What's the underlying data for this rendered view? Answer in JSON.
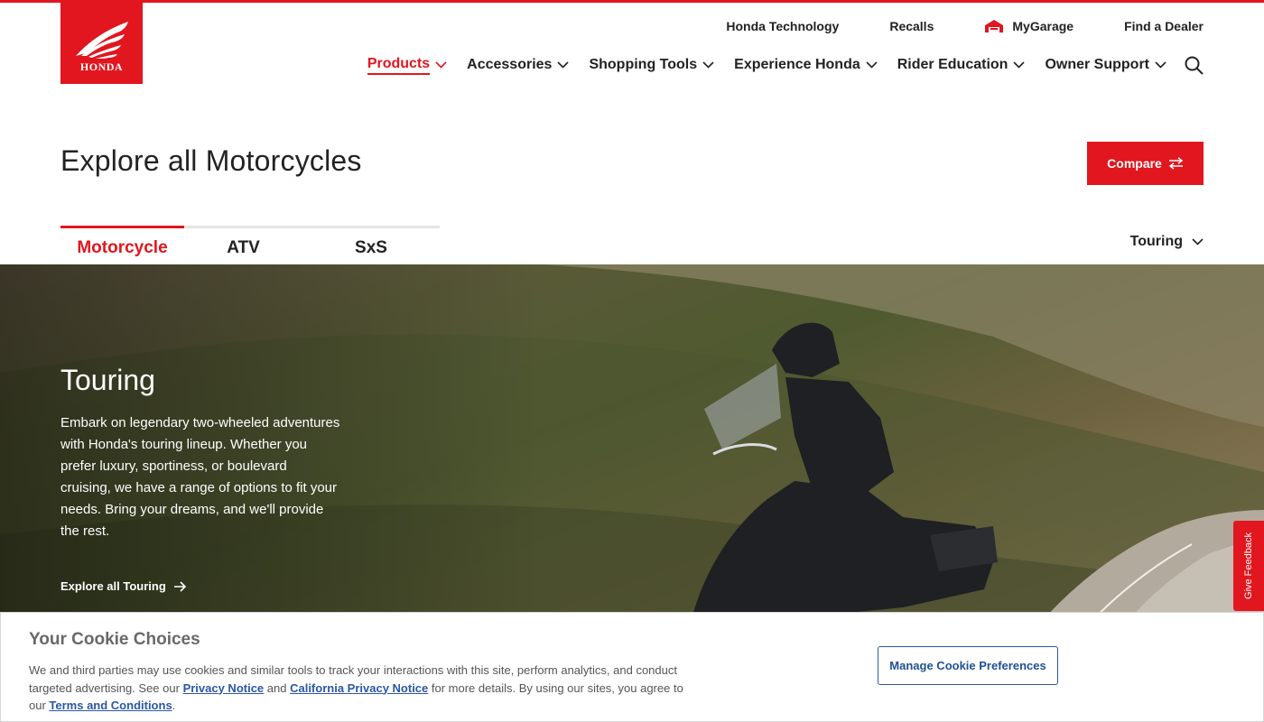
{
  "brand": {
    "logo_text": "HONDA",
    "accent_color": "#e1161e"
  },
  "utility_nav": {
    "technology": "Honda Technology",
    "recalls": "Recalls",
    "garage": "MyGarage",
    "dealer": "Find a Dealer"
  },
  "main_nav": {
    "items": [
      {
        "label": "Products",
        "active": true
      },
      {
        "label": "Accessories"
      },
      {
        "label": "Shopping Tools"
      },
      {
        "label": "Experience Honda"
      },
      {
        "label": "Rider Education"
      },
      {
        "label": "Owner Support"
      }
    ],
    "search_icon": "search-icon"
  },
  "page": {
    "title": "Explore all Motorcycles",
    "compare_label": "Compare"
  },
  "tabs": [
    {
      "label": "Motorcycle",
      "active": true
    },
    {
      "label": "ATV"
    },
    {
      "label": "SxS"
    }
  ],
  "filter": {
    "selected": "Touring"
  },
  "hero": {
    "title": "Touring",
    "description": "Embark on legendary two-wheeled adventures with Honda's touring lineup. Whether you prefer luxury, sportiness, or boulevard cruising, we have a range of options to fit your needs. Bring your dreams, and we'll provide the rest.",
    "link_label": "Explore all Touring"
  },
  "feedback": {
    "label": "Give Feedback"
  },
  "cookie": {
    "title": "Your Cookie Choices",
    "text_1": "We and third parties may use cookies and similar tools to track your interactions with this site, perform analytics, and conduct targeted advertising. See our ",
    "privacy_link": "Privacy Notice",
    "text_2": " and ",
    "ca_privacy_link": "California Privacy Notice",
    "text_3": " for more details. By using our sites, you agree to our ",
    "terms_link": "Terms and Conditions",
    "text_4": ".",
    "button_label": "Manage Cookie Preferences"
  }
}
